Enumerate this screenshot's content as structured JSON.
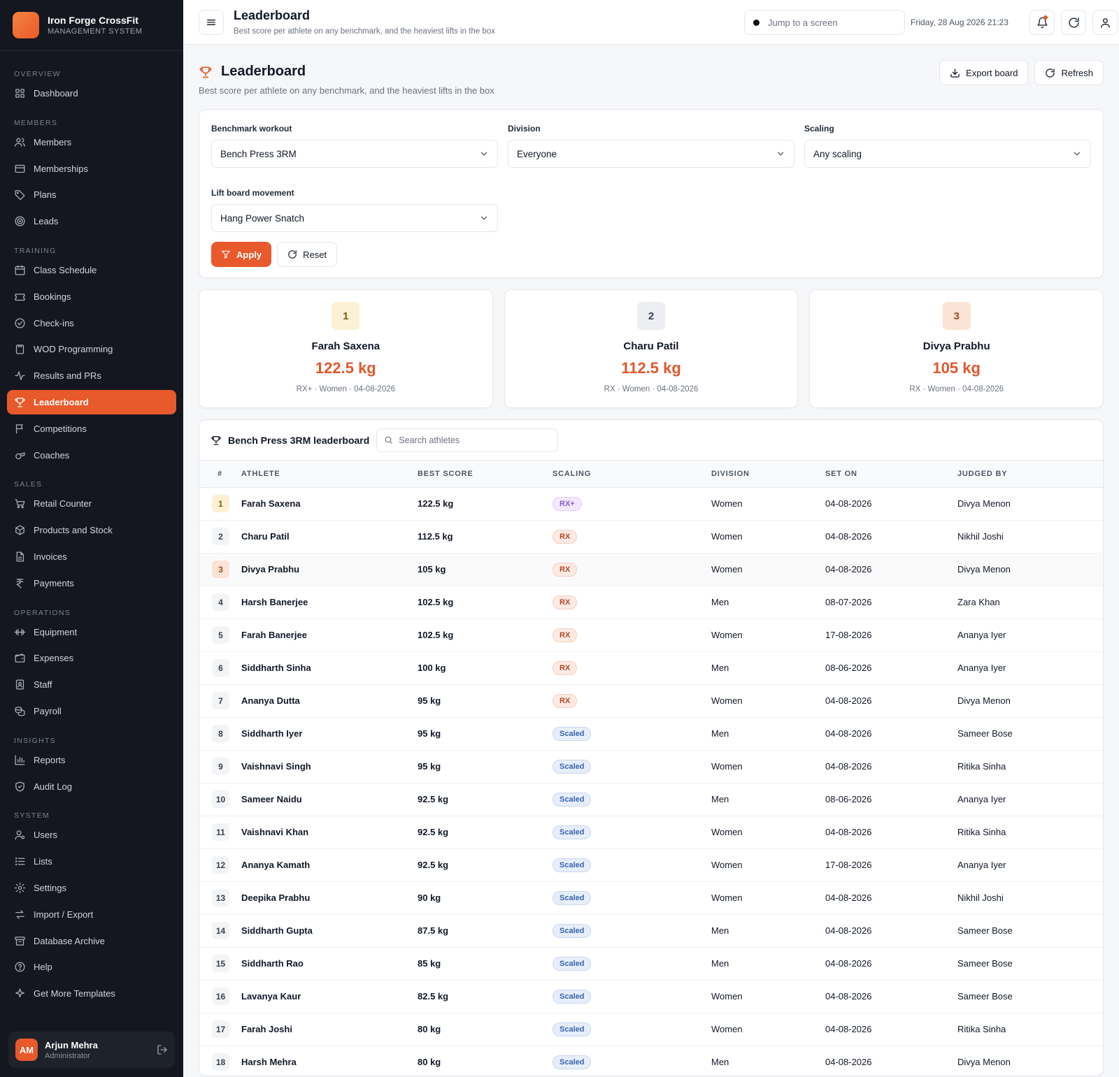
{
  "brand": {
    "name": "Iron Forge CrossFit",
    "subtitle": "MANAGEMENT SYSTEM"
  },
  "sidebar": {
    "sections": [
      {
        "label": "OVERVIEW",
        "items": [
          {
            "label": "Dashboard",
            "icon": "grid-icon"
          }
        ]
      },
      {
        "label": "MEMBERS",
        "items": [
          {
            "label": "Members",
            "icon": "users-icon"
          },
          {
            "label": "Memberships",
            "icon": "card-icon"
          },
          {
            "label": "Plans",
            "icon": "tag-icon"
          },
          {
            "label": "Leads",
            "icon": "target-icon"
          }
        ]
      },
      {
        "label": "TRAINING",
        "items": [
          {
            "label": "Class Schedule",
            "icon": "calendar-icon"
          },
          {
            "label": "Bookings",
            "icon": "ticket-icon"
          },
          {
            "label": "Check-ins",
            "icon": "check-circle-icon"
          },
          {
            "label": "WOD Programming",
            "icon": "clipboard-icon"
          },
          {
            "label": "Results and PRs",
            "icon": "activity-icon"
          },
          {
            "label": "Leaderboard",
            "icon": "trophy-icon",
            "active": true
          },
          {
            "label": "Competitions",
            "icon": "flag-icon"
          },
          {
            "label": "Coaches",
            "icon": "whistle-icon"
          }
        ]
      },
      {
        "label": "SALES",
        "items": [
          {
            "label": "Retail Counter",
            "icon": "cart-icon"
          },
          {
            "label": "Products and Stock",
            "icon": "box-icon"
          },
          {
            "label": "Invoices",
            "icon": "file-icon"
          },
          {
            "label": "Payments",
            "icon": "rupee-icon"
          }
        ]
      },
      {
        "label": "OPERATIONS",
        "items": [
          {
            "label": "Equipment",
            "icon": "dumbbell-icon"
          },
          {
            "label": "Expenses",
            "icon": "wallet-icon"
          },
          {
            "label": "Staff",
            "icon": "badge-icon"
          },
          {
            "label": "Payroll",
            "icon": "coins-icon"
          }
        ]
      },
      {
        "label": "INSIGHTS",
        "items": [
          {
            "label": "Reports",
            "icon": "bar-chart-icon"
          },
          {
            "label": "Audit Log",
            "icon": "shield-icon"
          }
        ]
      },
      {
        "label": "SYSTEM",
        "items": [
          {
            "label": "Users",
            "icon": "user-cog-icon"
          },
          {
            "label": "Lists",
            "icon": "list-icon"
          },
          {
            "label": "Settings",
            "icon": "gear-icon"
          },
          {
            "label": "Import / Export",
            "icon": "swap-icon"
          },
          {
            "label": "Database Archive",
            "icon": "archive-icon"
          },
          {
            "label": "Help",
            "icon": "help-icon"
          },
          {
            "label": "Get More Templates",
            "icon": "sparkle-icon"
          }
        ]
      }
    ]
  },
  "user": {
    "initials": "AM",
    "name": "Arjun Mehra",
    "role": "Administrator"
  },
  "topbar": {
    "title": "Leaderboard",
    "subtitle": "Best score per athlete on any benchmark, and the heaviest lifts in the box",
    "jump_placeholder": "Jump to a screen",
    "datetime": "Friday, 28 Aug 2026 21:23"
  },
  "page": {
    "title": "Leaderboard",
    "subtitle": "Best score per athlete on any benchmark, and the heaviest lifts in the box",
    "export_label": "Export board",
    "refresh_label": "Refresh"
  },
  "filters": {
    "benchmark": {
      "label": "Benchmark workout",
      "value": "Bench Press 3RM"
    },
    "division": {
      "label": "Division",
      "value": "Everyone"
    },
    "scaling": {
      "label": "Scaling",
      "value": "Any scaling"
    },
    "lift": {
      "label": "Lift board movement",
      "value": "Hang Power Snatch"
    },
    "apply_label": "Apply",
    "reset_label": "Reset"
  },
  "podium": [
    {
      "rank": "1",
      "name": "Farah Saxena",
      "score": "122.5 kg",
      "meta": "RX+ · Women · 04-08-2026"
    },
    {
      "rank": "2",
      "name": "Charu Patil",
      "score": "112.5 kg",
      "meta": "RX · Women · 04-08-2026"
    },
    {
      "rank": "3",
      "name": "Divya Prabhu",
      "score": "105 kg",
      "meta": "RX · Women · 04-08-2026"
    }
  ],
  "board": {
    "title": "Bench Press 3RM leaderboard",
    "search_placeholder": "Search athletes",
    "columns": [
      "#",
      "ATHLETE",
      "BEST SCORE",
      "SCALING",
      "DIVISION",
      "SET ON",
      "JUDGED BY"
    ],
    "rows": [
      {
        "rank": "1",
        "athlete": "Farah Saxena",
        "score": "122.5 kg",
        "scaling": "RX+",
        "division": "Women",
        "set_on": "04-08-2026",
        "judge": "Divya Menon"
      },
      {
        "rank": "2",
        "athlete": "Charu Patil",
        "score": "112.5 kg",
        "scaling": "RX",
        "division": "Women",
        "set_on": "04-08-2026",
        "judge": "Nikhil Joshi"
      },
      {
        "rank": "3",
        "athlete": "Divya Prabhu",
        "score": "105 kg",
        "scaling": "RX",
        "division": "Women",
        "set_on": "04-08-2026",
        "judge": "Divya Menon"
      },
      {
        "rank": "4",
        "athlete": "Harsh Banerjee",
        "score": "102.5 kg",
        "scaling": "RX",
        "division": "Men",
        "set_on": "08-07-2026",
        "judge": "Zara Khan"
      },
      {
        "rank": "5",
        "athlete": "Farah Banerjee",
        "score": "102.5 kg",
        "scaling": "RX",
        "division": "Women",
        "set_on": "17-08-2026",
        "judge": "Ananya Iyer"
      },
      {
        "rank": "6",
        "athlete": "Siddharth Sinha",
        "score": "100 kg",
        "scaling": "RX",
        "division": "Men",
        "set_on": "08-06-2026",
        "judge": "Ananya Iyer"
      },
      {
        "rank": "7",
        "athlete": "Ananya Dutta",
        "score": "95 kg",
        "scaling": "RX",
        "division": "Women",
        "set_on": "04-08-2026",
        "judge": "Divya Menon"
      },
      {
        "rank": "8",
        "athlete": "Siddharth Iyer",
        "score": "95 kg",
        "scaling": "Scaled",
        "division": "Men",
        "set_on": "04-08-2026",
        "judge": "Sameer Bose"
      },
      {
        "rank": "9",
        "athlete": "Vaishnavi Singh",
        "score": "95 kg",
        "scaling": "Scaled",
        "division": "Women",
        "set_on": "04-08-2026",
        "judge": "Ritika Sinha"
      },
      {
        "rank": "10",
        "athlete": "Sameer Naidu",
        "score": "92.5 kg",
        "scaling": "Scaled",
        "division": "Men",
        "set_on": "08-06-2026",
        "judge": "Ananya Iyer"
      },
      {
        "rank": "11",
        "athlete": "Vaishnavi Khan",
        "score": "92.5 kg",
        "scaling": "Scaled",
        "division": "Women",
        "set_on": "04-08-2026",
        "judge": "Ritika Sinha"
      },
      {
        "rank": "12",
        "athlete": "Ananya Kamath",
        "score": "92.5 kg",
        "scaling": "Scaled",
        "division": "Women",
        "set_on": "17-08-2026",
        "judge": "Ananya Iyer"
      },
      {
        "rank": "13",
        "athlete": "Deepika Prabhu",
        "score": "90 kg",
        "scaling": "Scaled",
        "division": "Women",
        "set_on": "04-08-2026",
        "judge": "Nikhil Joshi"
      },
      {
        "rank": "14",
        "athlete": "Siddharth Gupta",
        "score": "87.5 kg",
        "scaling": "Scaled",
        "division": "Men",
        "set_on": "04-08-2026",
        "judge": "Sameer Bose"
      },
      {
        "rank": "15",
        "athlete": "Siddharth Rao",
        "score": "85 kg",
        "scaling": "Scaled",
        "division": "Men",
        "set_on": "04-08-2026",
        "judge": "Sameer Bose"
      },
      {
        "rank": "16",
        "athlete": "Lavanya Kaur",
        "score": "82.5 kg",
        "scaling": "Scaled",
        "division": "Women",
        "set_on": "04-08-2026",
        "judge": "Sameer Bose"
      },
      {
        "rank": "17",
        "athlete": "Farah Joshi",
        "score": "80 kg",
        "scaling": "Scaled",
        "division": "Women",
        "set_on": "04-08-2026",
        "judge": "Ritika Sinha"
      },
      {
        "rank": "18",
        "athlete": "Harsh Mehra",
        "score": "80 kg",
        "scaling": "Scaled",
        "division": "Men",
        "set_on": "04-08-2026",
        "judge": "Divya Menon"
      }
    ]
  },
  "colors": {
    "accent": "#e8592b",
    "sidebar_bg": "#14171f",
    "page_bg": "#f6f7f9"
  }
}
